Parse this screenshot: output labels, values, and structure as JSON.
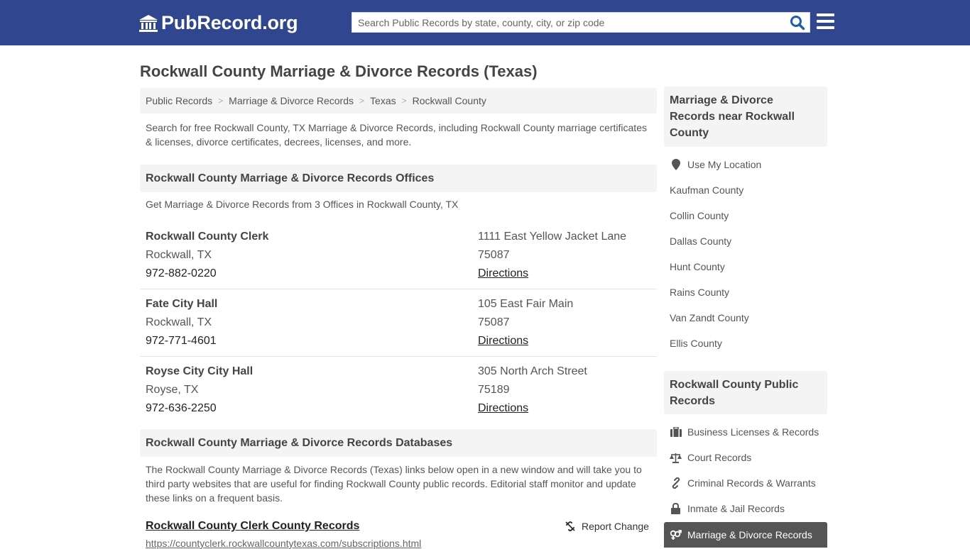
{
  "header": {
    "logo_text": "PubRecord.org",
    "logo_icon": "courthouse-icon",
    "search_placeholder": "Search Public Records by state, county, city, or zip code",
    "search_icon": "search-icon",
    "menu_icon": "hamburger-menu-icon",
    "brand_color": "#30468f"
  },
  "page": {
    "title": "Rockwall County Marriage & Divorce Records (Texas)",
    "breadcrumb": [
      "Public Records",
      "Marriage & Divorce Records",
      "Texas",
      "Rockwall County"
    ],
    "breadcrumb_separator": ">",
    "intro": "Search for free Rockwall County, TX Marriage & Divorce Records, including Rockwall County marriage certificates & licenses, divorce certificates, decrees, licenses, and more."
  },
  "offices": {
    "heading": "Rockwall County Marriage & Divorce Records Offices",
    "subtitle": "Get Marriage & Divorce Records from 3 Offices in Rockwall County, TX",
    "items": [
      {
        "name": "Rockwall County Clerk",
        "city": "Rockwall, TX",
        "phone": "972-882-0220",
        "address": "1111 East Yellow Jacket Lane",
        "zip": "75087",
        "directions": "Directions"
      },
      {
        "name": "Fate City Hall",
        "city": "Rockwall, TX",
        "phone": "972-771-4601",
        "address": "105 East Fair Main",
        "zip": "75087",
        "directions": "Directions"
      },
      {
        "name": "Royse City City Hall",
        "city": "Royse, TX",
        "phone": "972-636-2250",
        "address": "305 North Arch Street",
        "zip": "75189",
        "directions": "Directions"
      }
    ]
  },
  "databases": {
    "heading": "Rockwall County Marriage & Divorce Records Databases",
    "description": "The Rockwall County Marriage & Divorce Records (Texas) links below open in a new window and will take you to third party websites that are useful for finding Rockwall County public records. Editorial staff monitor and update these links on a frequent basis.",
    "items": [
      {
        "title": "Rockwall County Clerk County Records",
        "url": "https://countyclerk.rockwallcountytexas.com/subscriptions.html",
        "report_label": "Report Change",
        "report_icon": "broken-link-icon"
      }
    ]
  },
  "sidebar": {
    "nearby": {
      "heading": "Marriage & Divorce Records near Rockwall County",
      "use_location": {
        "label": "Use My Location",
        "icon": "map-marker-icon"
      },
      "counties": [
        "Kaufman County",
        "Collin County",
        "Dallas County",
        "Hunt County",
        "Rains County",
        "Van Zandt County",
        "Ellis County"
      ]
    },
    "public_records": {
      "heading": "Rockwall County Public Records",
      "items": [
        {
          "label": "Business Licenses & Records",
          "icon": "briefcase-icon",
          "active": false
        },
        {
          "label": "Court Records",
          "icon": "scales-icon",
          "active": false
        },
        {
          "label": "Criminal Records & Warrants",
          "icon": "link-icon",
          "active": false
        },
        {
          "label": "Inmate & Jail Records",
          "icon": "lock-icon",
          "active": false
        },
        {
          "label": "Marriage & Divorce Records",
          "icon": "venus-mars-icon",
          "active": true
        }
      ]
    }
  }
}
